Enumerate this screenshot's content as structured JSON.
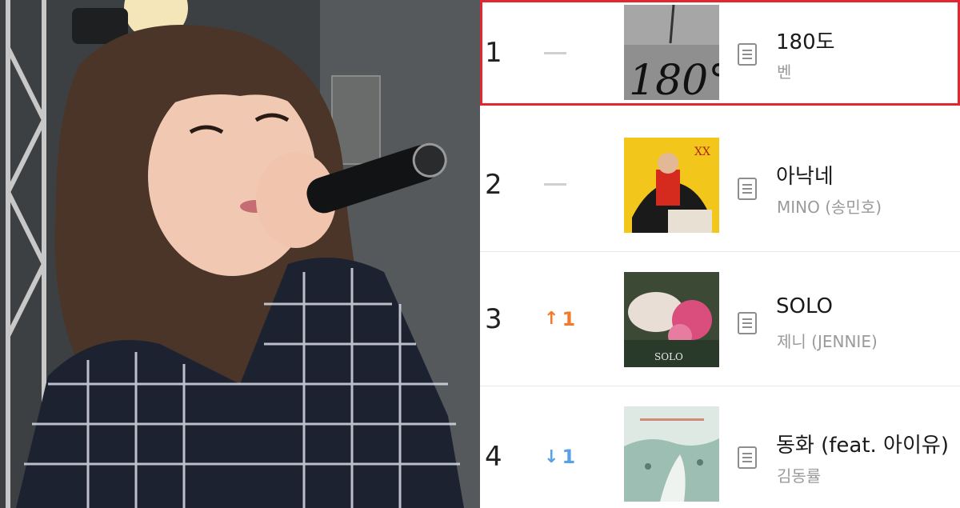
{
  "photo": {
    "description_icon": "performer-photo"
  },
  "chart": {
    "highlight_color": "#e3262f",
    "up_color": "#f5792a",
    "down_color": "#5aa0e6",
    "entries": [
      {
        "rank": "1",
        "change": "",
        "change_type": "same",
        "title": "180도",
        "artist": "벤",
        "cover_text": "180°",
        "icon": "lyrics-icon"
      },
      {
        "rank": "2",
        "change": "",
        "change_type": "same",
        "title": "아낙네",
        "artist": "MINO (송민호)",
        "cover_text": "XX",
        "icon": "lyrics-icon"
      },
      {
        "rank": "3",
        "change": "1",
        "change_type": "up",
        "title": "SOLO",
        "artist": "제니 (JENNIE)",
        "cover_text": "SOLO",
        "icon": "lyrics-icon"
      },
      {
        "rank": "4",
        "change": "1",
        "change_type": "down",
        "title": "동화 (feat. 아이유)",
        "artist": "김동률",
        "cover_text": "",
        "icon": "lyrics-icon"
      }
    ]
  }
}
